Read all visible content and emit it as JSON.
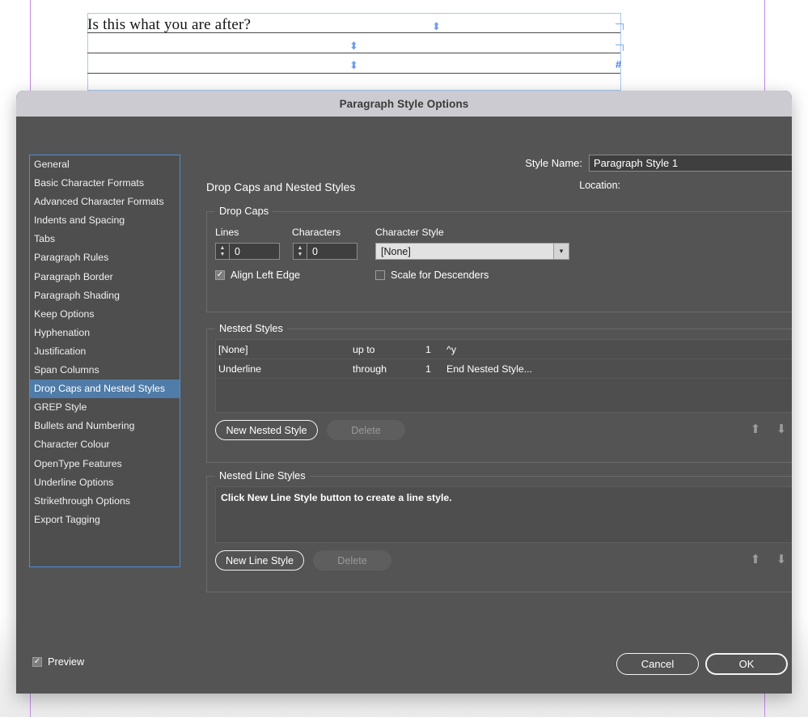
{
  "document": {
    "title_text": "Is this what you are after?",
    "markers": [
      "⬍",
      "⬍",
      "⬍",
      "#"
    ]
  },
  "dialog": {
    "title": "Paragraph Style Options",
    "style_name": {
      "label": "Style Name:",
      "value": "Paragraph Style 1"
    },
    "location": {
      "label": "Location:",
      "value": ""
    },
    "section_heading": "Drop Caps and Nested Styles",
    "sidebar": {
      "items": [
        {
          "label": "General",
          "selected": false
        },
        {
          "label": "Basic Character Formats",
          "selected": false
        },
        {
          "label": "Advanced Character Formats",
          "selected": false
        },
        {
          "label": "Indents and Spacing",
          "selected": false
        },
        {
          "label": "Tabs",
          "selected": false
        },
        {
          "label": "Paragraph Rules",
          "selected": false
        },
        {
          "label": "Paragraph Border",
          "selected": false
        },
        {
          "label": "Paragraph Shading",
          "selected": false
        },
        {
          "label": "Keep Options",
          "selected": false
        },
        {
          "label": "Hyphenation",
          "selected": false
        },
        {
          "label": "Justification",
          "selected": false
        },
        {
          "label": "Span Columns",
          "selected": false
        },
        {
          "label": "Drop Caps and Nested Styles",
          "selected": true
        },
        {
          "label": "GREP Style",
          "selected": false
        },
        {
          "label": "Bullets and Numbering",
          "selected": false
        },
        {
          "label": "Character Colour",
          "selected": false
        },
        {
          "label": "OpenType Features",
          "selected": false
        },
        {
          "label": "Underline Options",
          "selected": false
        },
        {
          "label": "Strikethrough Options",
          "selected": false
        },
        {
          "label": "Export Tagging",
          "selected": false
        }
      ]
    },
    "drop_caps": {
      "group_title": "Drop Caps",
      "lines_label": "Lines",
      "lines_value": "0",
      "characters_label": "Characters",
      "characters_value": "0",
      "character_style_label": "Character Style",
      "character_style_value": "[None]",
      "align_left_edge_label": "Align Left Edge",
      "align_left_edge_checked": true,
      "scale_for_descenders_label": "Scale for Descenders",
      "scale_for_descenders_checked": false
    },
    "nested_styles": {
      "group_title": "Nested Styles",
      "rows": [
        {
          "style": "[None]",
          "relation": "up to",
          "count": "1",
          "target": "^y"
        },
        {
          "style": "Underline",
          "relation": "through",
          "count": "1",
          "target": "End Nested Style..."
        }
      ],
      "new_button": "New Nested Style",
      "delete_button": "Delete",
      "move_up_icon": "arrow-up-icon",
      "move_down_icon": "arrow-down-icon"
    },
    "nested_line_styles": {
      "group_title": "Nested Line Styles",
      "empty_message": "Click New Line Style button to create a line style.",
      "new_button": "New Line Style",
      "delete_button": "Delete",
      "move_up_icon": "arrow-up-icon",
      "move_down_icon": "arrow-down-icon"
    },
    "footer": {
      "preview_label": "Preview",
      "preview_checked": true,
      "cancel_label": "Cancel",
      "ok_label": "OK"
    },
    "colors": {
      "dialog_bg": "#545454",
      "titlebar_bg": "#cbcbd1",
      "selection_blue": "#4f7ca8",
      "list_border_blue": "#4a8fd8",
      "guide_purple": "#c08ae8"
    }
  }
}
